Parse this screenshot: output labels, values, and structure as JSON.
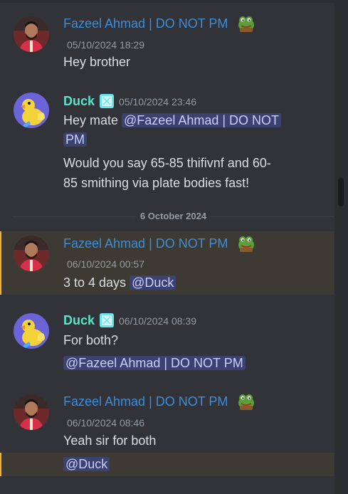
{
  "divider": {
    "date": "6 October 2024"
  },
  "users": {
    "fazeel": {
      "name": "Fazeel Ahmad | DO NOT PM"
    },
    "duck": {
      "name": "Duck"
    }
  },
  "messages": [
    {
      "author": "Fazeel Ahmad | DO NOT PM",
      "timestamp": "05/10/2024 18:29",
      "lines": [
        "Hey brother"
      ]
    },
    {
      "author": "Duck",
      "timestamp": "05/10/2024 23:46",
      "line1_text": "Hey mate ",
      "line1_mention": "@Fazeel Ahmad | DO NOT",
      "line2_mention": "PM",
      "line3": "Would you say 65-85 thifivnf and 60-",
      "line4": "85 smithing via plate bodies fast!"
    },
    {
      "author": "Fazeel Ahmad | DO NOT PM",
      "timestamp": "06/10/2024 00:57",
      "text": "3 to 4 days ",
      "mention": "@Duck"
    },
    {
      "author": "Duck",
      "timestamp": "06/10/2024 08:39",
      "line1": "For both?",
      "mention": "@Fazeel Ahmad | DO NOT PM"
    },
    {
      "author": "Fazeel Ahmad | DO NOT PM",
      "timestamp": "06/10/2024 08:46",
      "line1": "Yeah sir for both",
      "mention": "@Duck"
    }
  ],
  "colors": {
    "background": "#313338",
    "fazeel_name": "#3b8edb",
    "duck_name": "#5ae4c7",
    "mention_bg": "#3c4270",
    "highlight_bg": "#3d3a34",
    "highlight_bar": "#f0b232"
  },
  "icons": {
    "user_emoji": "pepe-frog-icon",
    "bot_badge": "verified-badge-icon"
  }
}
